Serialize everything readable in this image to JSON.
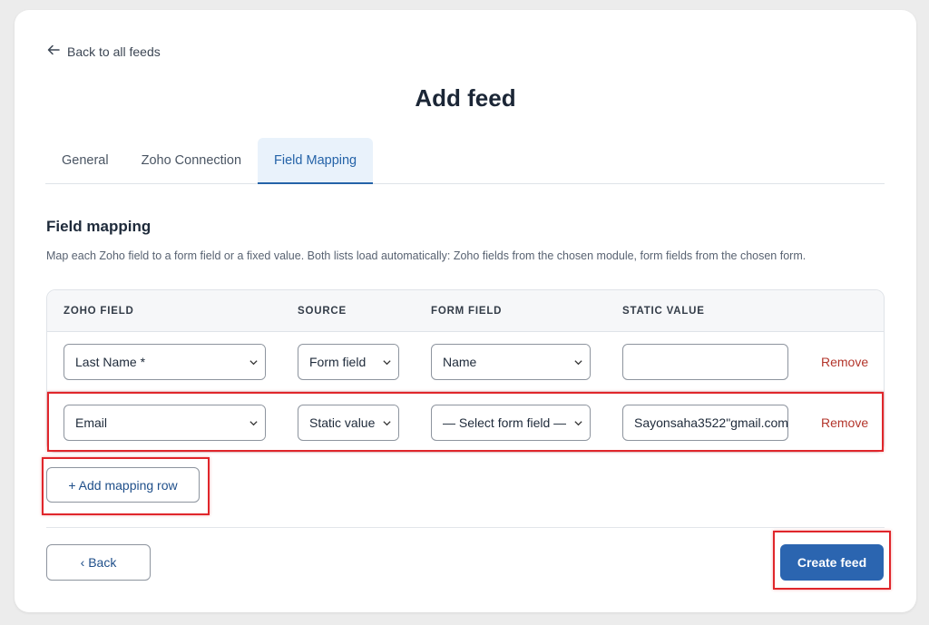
{
  "nav": {
    "back_label": "Back to all feeds"
  },
  "page_title": "Add feed",
  "tabs": [
    {
      "label": "General"
    },
    {
      "label": "Zoho Connection"
    },
    {
      "label": "Field Mapping",
      "active": true
    }
  ],
  "section": {
    "title": "Field mapping",
    "description": "Map each Zoho field to a form field or a fixed value. Both lists load automatically: Zoho fields from the chosen module, form fields from the chosen form."
  },
  "table": {
    "headers": [
      "ZOHO FIELD",
      "SOURCE",
      "FORM FIELD",
      "STATIC VALUE"
    ],
    "rows": [
      {
        "zoho_field": "Last Name *",
        "source": "Form field",
        "form_field": "Name",
        "static_value": "",
        "remove_label": "Remove"
      },
      {
        "zoho_field": "Email",
        "source": "Static value",
        "form_field": "— Select form field —",
        "static_value": "Sayonsaha3522\"gmail.com",
        "remove_label": "Remove"
      }
    ]
  },
  "add_row_label": "+ Add mapping row",
  "footer": {
    "back_label": "‹ Back",
    "create_label": "Create feed"
  },
  "colors": {
    "accent": "#2b65b0",
    "remove": "#b3352b",
    "highlight": "#e0262b"
  }
}
